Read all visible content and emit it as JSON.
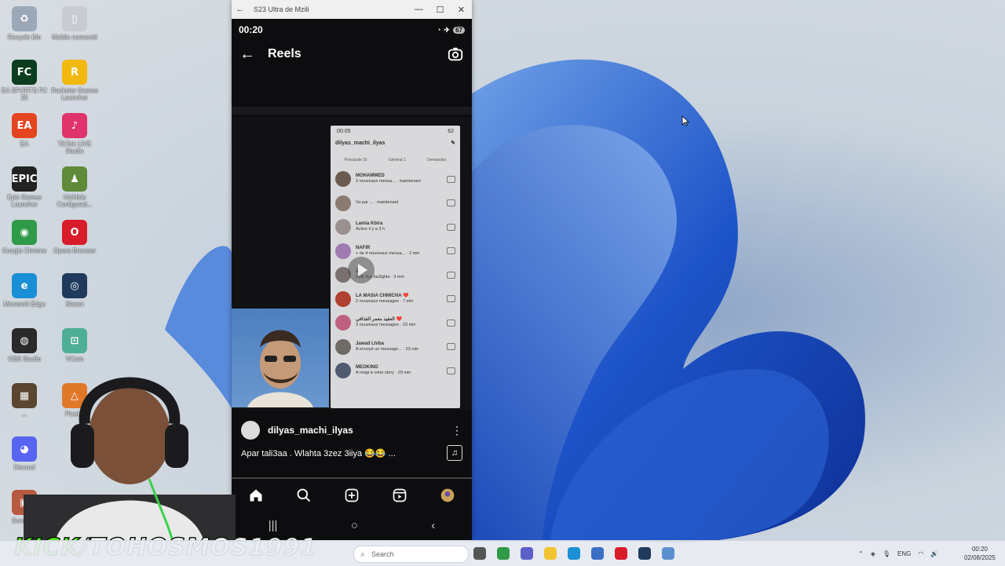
{
  "desktop": {
    "icons": [
      {
        "label": "Recycle Bin",
        "glyph": "♻",
        "color": "#9aa8b8"
      },
      {
        "label": "Mobile connecté",
        "glyph": "▯",
        "color": "#c8ccd2"
      },
      {
        "label": "EA SPORTS FC 25",
        "glyph": "FC",
        "color": "#0b3d1e"
      },
      {
        "label": "Rockstar Games Launcher",
        "glyph": "R",
        "color": "#f1b80e"
      },
      {
        "label": "EA",
        "glyph": "EA",
        "color": "#e4441f"
      },
      {
        "label": "TikTok LIVE Studio",
        "glyph": "♪",
        "color": "#e0336b"
      },
      {
        "label": "Epic Games Launcher",
        "glyph": "EPIC",
        "color": "#222"
      },
      {
        "label": "HidHide Configurati...",
        "glyph": "♟",
        "color": "#5f8a3a"
      },
      {
        "label": "Google Chrome",
        "glyph": "◉",
        "color": "#2f9a48"
      },
      {
        "label": "Opera Browser",
        "glyph": "O",
        "color": "#d81c2a"
      },
      {
        "label": "Microsoft Edge",
        "glyph": "e",
        "color": "#1b8fd6"
      },
      {
        "label": "Steam",
        "glyph": "◎",
        "color": "#1f3a5c"
      },
      {
        "label": "OBS Studio",
        "glyph": "◍",
        "color": "#2a2a2a"
      },
      {
        "label": "VCam",
        "glyph": "⊡",
        "color": "#4fae96"
      },
      {
        "label": "...",
        "glyph": "▦",
        "color": "#5a4630"
      },
      {
        "label": "Pixel...",
        "glyph": "△",
        "color": "#e0782a"
      },
      {
        "label": "Discord",
        "glyph": "◕",
        "color": "#5865f2"
      },
      {
        "label": "Screen...",
        "glyph": "▣",
        "color": "#b85a40"
      }
    ]
  },
  "emulator": {
    "window_title": "S23 Ultra de Mzili",
    "controls": {
      "back": "←",
      "minimize": "—",
      "maximize": "☐",
      "close": "✕"
    },
    "status": {
      "time": "00:20",
      "battery": "67"
    },
    "header": {
      "back": "←",
      "title": "Reels"
    },
    "reel": {
      "phone_time": "00:05",
      "phone_battery": "62",
      "phone_username": "dilyas_machi_ilyas",
      "tabs": [
        "Principale 16",
        "Général 1",
        "Demandes"
      ],
      "messages": [
        {
          "name": "MOHAMMED",
          "sub": "2 nouveaux messa... · maintenant"
        },
        {
          "name": "",
          "sub": "Vu par ... · maintenant"
        },
        {
          "name": "Lamia Kbira",
          "sub": "Active il y a 3 h"
        },
        {
          "name": "NAFIR",
          "sub": "+ de 4 nouveaux messa... · 2 min"
        },
        {
          "name": "Z.aH",
          "sub": "Salit 3ya ba3ighla · 3 min"
        },
        {
          "name": "LA MASIA CHMICHA ❤️",
          "sub": "2 nouveaux messages · 7 min"
        },
        {
          "name": "العقيد معمر القذافي ❤️",
          "sub": "3 nouveaux messages · 23 min"
        },
        {
          "name": "Jawad Lhiba",
          "sub": "A envoyé un message... · 23 min"
        },
        {
          "name": "MEOKING",
          "sub": "A réagi à votre story · 29 min"
        }
      ],
      "progress": 0.0
    },
    "author": "dilyas_machi_ilyas",
    "caption": "Apar tali3aa . Wlahta 3zez 3iiya 😂😂 ...",
    "more": "⋮",
    "music": "♫",
    "nav": [
      "home-icon",
      "search-icon",
      "create-icon",
      "reels-icon",
      "profile-icon"
    ],
    "sys_nav": [
      "|||",
      "○",
      "‹"
    ]
  },
  "overlay": {
    "kick_prefix": "KICK",
    "kick_rest": "/TOHOSMOS1991"
  },
  "taskbar": {
    "search_placeholder": "Search",
    "lang": "ENG",
    "time": "00:20",
    "date": "02/08/2025",
    "apps": [
      {
        "name": "task-view",
        "color": "#555"
      },
      {
        "name": "chrome",
        "color": "#2f9a48"
      },
      {
        "name": "teams",
        "color": "#5b5fc7"
      },
      {
        "name": "explorer",
        "color": "#f2c431"
      },
      {
        "name": "edge",
        "color": "#1b8fd6"
      },
      {
        "name": "store",
        "color": "#3a6fc4"
      },
      {
        "name": "opera",
        "color": "#d81c2a"
      },
      {
        "name": "steam",
        "color": "#1f3a5c"
      },
      {
        "name": "mobile",
        "color": "#5c8fd0"
      }
    ]
  }
}
